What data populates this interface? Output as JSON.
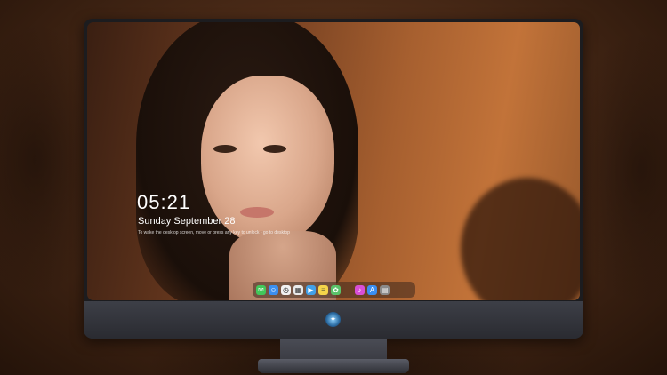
{
  "lockscreen": {
    "time": "05:21",
    "date": "Sunday September  28",
    "hint": "To wake the desktop screen, move or press any key to unlock - go to desktop"
  },
  "dock": {
    "items": [
      {
        "name": "messages-icon",
        "glyph": "✉",
        "color": "#42c75a"
      },
      {
        "name": "finder-icon",
        "glyph": "☺",
        "color": "#3b8ff0"
      },
      {
        "name": "clock-icon",
        "glyph": "◷",
        "color": "#f2f2f2"
      },
      {
        "name": "calendar-icon",
        "glyph": "▦",
        "color": "#e9e9e9"
      },
      {
        "name": "video-icon",
        "glyph": "▶",
        "color": "#42a0e8"
      },
      {
        "name": "notes-icon",
        "glyph": "≡",
        "color": "#f5d44a"
      },
      {
        "name": "photos-icon",
        "glyph": "✿",
        "color": "#5ac26a"
      },
      {
        "name": "music-icon",
        "glyph": "♪",
        "color": "#d84fd6"
      },
      {
        "name": "appstore-icon",
        "glyph": "A",
        "color": "#3a8ef2"
      },
      {
        "name": "files-icon",
        "glyph": "▤",
        "color": "#8a8a8a"
      }
    ]
  },
  "brand": {
    "logo_icon": "brand-logo-icon"
  }
}
